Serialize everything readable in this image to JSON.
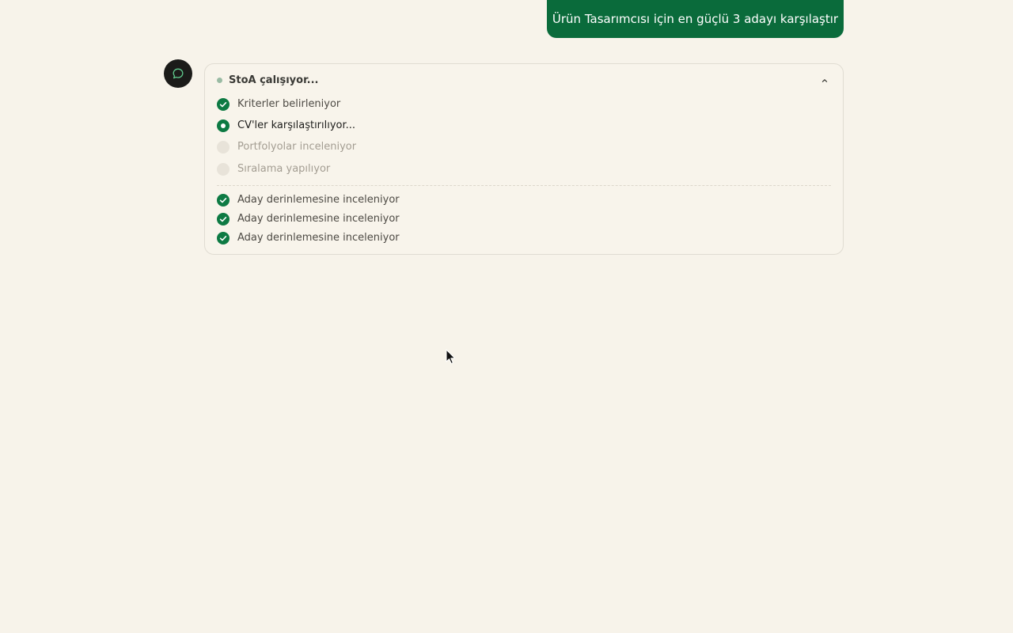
{
  "user_message": {
    "text": "Ürün Tasarımcısı için en güçlü 3 adayı karşılaştır"
  },
  "agent": {
    "avatar_icon": "chat-bubble-icon",
    "status_text": "StoA çalışıyor...",
    "collapse_icon": "chevron-up-icon",
    "steps": [
      {
        "label": "Kriterler belirleniyor",
        "state": "done"
      },
      {
        "label": "CV'ler karşılaştırılıyor...",
        "state": "active"
      },
      {
        "label": "Portfolyolar inceleniyor",
        "state": "pending"
      },
      {
        "label": "Sıralama yapılıyor",
        "state": "pending"
      }
    ],
    "substeps": [
      {
        "label": "Aday derinlemesine inceleniyor",
        "state": "done"
      },
      {
        "label": "Aday derinlemesine inceleniyor",
        "state": "done"
      },
      {
        "label": "Aday derinlemesine inceleniyor",
        "state": "done"
      }
    ]
  },
  "colors": {
    "background": "#f7f3ea",
    "accent_green": "#0a6b3b",
    "pending_grey": "#e8e3d9"
  }
}
